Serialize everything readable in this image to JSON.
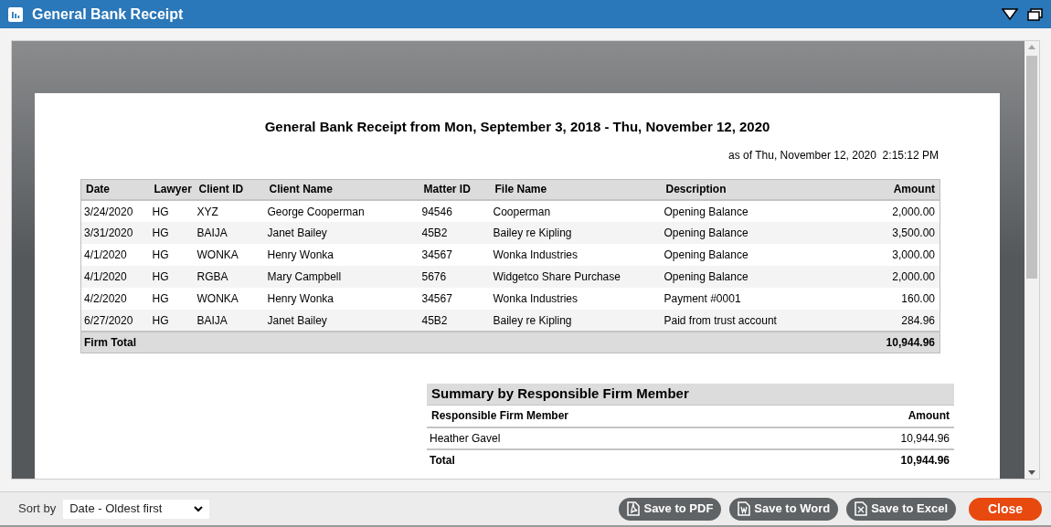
{
  "window": {
    "title": "General Bank Receipt"
  },
  "report": {
    "title": "General Bank Receipt from Mon, September 3, 2018 - Thu, November 12, 2020",
    "as_of": "as of Thu, November 12, 2020  2:15:12 PM",
    "table": {
      "columns": [
        "Date",
        "Lawyer",
        "Client ID",
        "Client Name",
        "Matter ID",
        "File Name",
        "Description",
        "Amount"
      ],
      "rows": [
        [
          "3/24/2020",
          "HG",
          "XYZ",
          "George Cooperman",
          "94546",
          "Cooperman",
          "Opening Balance",
          "2,000.00"
        ],
        [
          "3/31/2020",
          "HG",
          "BAIJA",
          "Janet Bailey",
          "45B2",
          "Bailey re Kipling",
          "Opening Balance",
          "3,500.00"
        ],
        [
          "4/1/2020",
          "HG",
          "WONKA",
          "Henry Wonka",
          "34567",
          "Wonka Industries",
          "Opening Balance",
          "3,000.00"
        ],
        [
          "4/1/2020",
          "HG",
          "RGBA",
          "Mary Campbell",
          "5676",
          "Widgetco Share Purchase",
          "Opening Balance",
          "2,000.00"
        ],
        [
          "4/2/2020",
          "HG",
          "WONKA",
          "Henry Wonka",
          "34567",
          "Wonka Industries",
          "Payment #0001",
          "160.00"
        ],
        [
          "6/27/2020",
          "HG",
          "BAIJA",
          "Janet Bailey",
          "45B2",
          "Bailey re Kipling",
          "Paid from trust account",
          "284.96"
        ]
      ],
      "total": {
        "label": "Firm Total",
        "amount": "10,944.96"
      }
    },
    "summary": {
      "title": "Summary by Responsible Firm Member",
      "columns": [
        "Responsible Firm Member",
        "Amount"
      ],
      "rows": [
        [
          "Heather Gavel",
          "10,944.96"
        ]
      ],
      "total": {
        "label": "Total",
        "amount": "10,944.96"
      }
    }
  },
  "footer": {
    "sort_label": "Sort by",
    "sort_value": "Date - Oldest first",
    "buttons": [
      {
        "label": "Save to PDF",
        "kind": "pdf"
      },
      {
        "label": "Save to Word",
        "kind": "word"
      },
      {
        "label": "Save to Excel",
        "kind": "excel"
      },
      {
        "label": "Close",
        "kind": "close"
      }
    ]
  }
}
